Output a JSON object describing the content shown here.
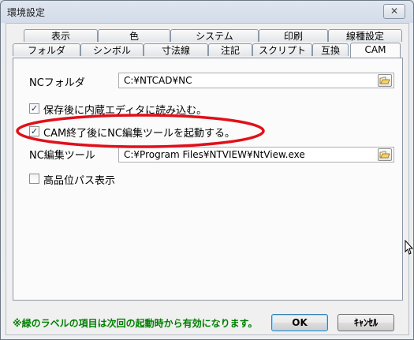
{
  "window": {
    "title": "環境設定",
    "close_glyph": "✕"
  },
  "tabs_row1": [
    "表示",
    "色",
    "システム",
    "印刷",
    "線種設定"
  ],
  "tabs_row2": [
    "フォルダ",
    "シンボル",
    "寸法線",
    "注記",
    "スクリプト",
    "互換",
    "CAM"
  ],
  "active_tab": "CAM",
  "cam": {
    "nc_folder_label": "NCフォルダ",
    "nc_folder_value": "C:¥NTCAD¥NC",
    "checkbox1_label": "保存後に内蔵エディタに読み込む。",
    "checkbox1_checked": true,
    "checkbox2_label": "CAM終了後にNC編集ツールを起動する。",
    "checkbox2_checked": true,
    "nc_tool_label": "NC編集ツール",
    "nc_tool_value": "C:¥Program Files¥NTVIEW¥NtView.exe",
    "checkbox3_label": "高品位パス表示",
    "checkbox3_checked": false,
    "check_glyph": "✓"
  },
  "footer": {
    "note": "※緑のラベルの項目は次回の起動時から有効になります。",
    "note_color": "#008000",
    "ok_label": "OK",
    "cancel_label": "ｷｬﾝｾﾙ"
  },
  "highlight_color": "#e0101a",
  "icons": {
    "folder": "folder-open-icon",
    "close": "close-icon",
    "cursor": "resize-cursor-icon"
  }
}
